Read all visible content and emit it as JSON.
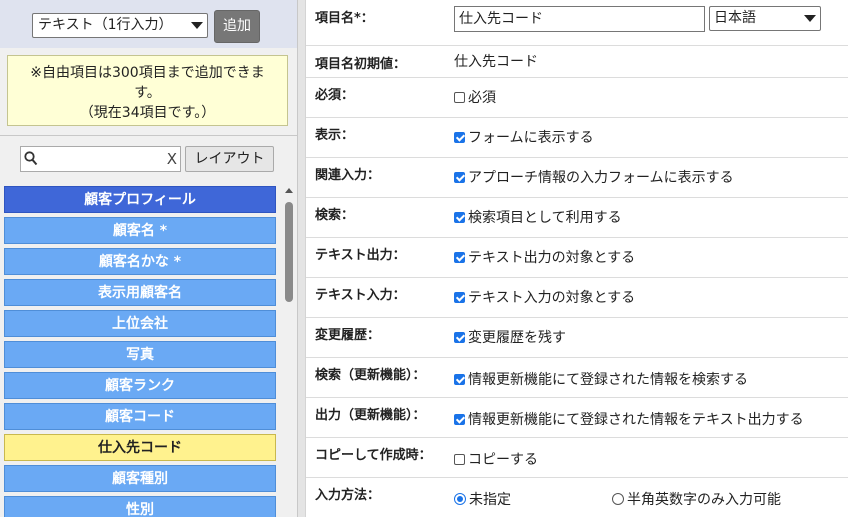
{
  "left_panel": {
    "type_select": {
      "value": "テキスト（1行入力）"
    },
    "add_button": "追加",
    "notice": {
      "line1": "※自由項目は300項目まで追加できます。",
      "line2": "（現在34項目です。）"
    },
    "search": {
      "placeholder": "",
      "clear": "X"
    },
    "layout_button": "レイアウト",
    "items": [
      {
        "label": "顧客プロフィール",
        "kind": "header"
      },
      {
        "label": "顧客名 *",
        "kind": "normal"
      },
      {
        "label": "顧客名かな *",
        "kind": "normal"
      },
      {
        "label": "表示用顧客名",
        "kind": "normal"
      },
      {
        "label": "上位会社",
        "kind": "normal"
      },
      {
        "label": "写真",
        "kind": "normal"
      },
      {
        "label": "顧客ランク",
        "kind": "normal"
      },
      {
        "label": "顧客コード",
        "kind": "normal"
      },
      {
        "label": "仕入先コード",
        "kind": "selected"
      },
      {
        "label": "顧客種別",
        "kind": "normal"
      },
      {
        "label": "性別",
        "kind": "normal"
      }
    ]
  },
  "form": {
    "item_name": {
      "label": "項目名*：",
      "value": "仕入先コード",
      "lang": "日本語"
    },
    "initial_name": {
      "label": "項目名初期値：",
      "value": "仕入先コード"
    },
    "required": {
      "label": "必須：",
      "text": "必須",
      "checked": false
    },
    "display": {
      "label": "表示：",
      "text": "フォームに表示する",
      "checked": true
    },
    "related_input": {
      "label": "関連入力：",
      "text": "アプローチ情報の入力フォームに表示する",
      "checked": true
    },
    "search": {
      "label": "検索：",
      "text": "検索項目として利用する",
      "checked": true
    },
    "text_output": {
      "label": "テキスト出力：",
      "text": "テキスト出力の対象とする",
      "checked": true
    },
    "text_input": {
      "label": "テキスト入力：",
      "text": "テキスト入力の対象とする",
      "checked": true
    },
    "history": {
      "label": "変更履歴：",
      "text": "変更履歴を残す",
      "checked": true
    },
    "search_update": {
      "label": "検索（更新機能）：",
      "text": "情報更新機能にて登録された情報を検索する",
      "checked": true
    },
    "output_update": {
      "label": "出力（更新機能）：",
      "text": "情報更新機能にて登録された情報をテキスト出力する",
      "checked": true
    },
    "copy": {
      "label": "コピーして作成時：",
      "text": "コピーする",
      "checked": false
    },
    "input_method": {
      "label": "入力方法：",
      "option1": "未指定",
      "option2": "半角英数字のみ入力可能",
      "selected": "未指定"
    }
  },
  "colors": {
    "header": "#3f67d8",
    "item": "#6aa9f4",
    "selected": "#fff28e",
    "notice": "#ffffd6",
    "check": "#1a73e8"
  }
}
